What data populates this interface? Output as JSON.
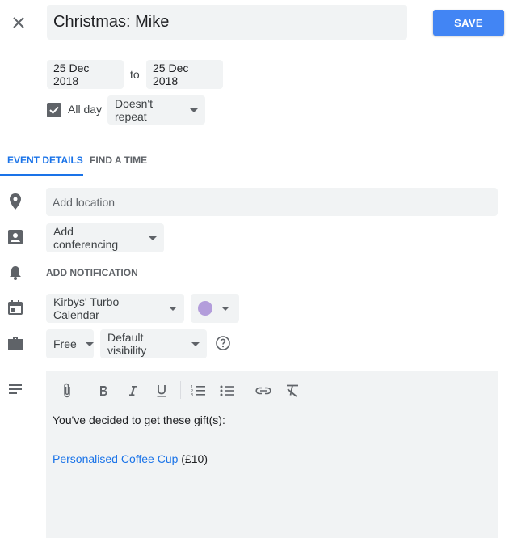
{
  "header": {
    "title_value": "Christmas: Mike",
    "save_label": "SAVE"
  },
  "dates": {
    "start": "25 Dec 2018",
    "separator": "to",
    "end": "25 Dec 2018"
  },
  "all_day": {
    "label": "All day",
    "checked": true
  },
  "repeat": {
    "selected": "Doesn't repeat"
  },
  "tabs": [
    {
      "label": "EVENT DETAILS",
      "active": true
    },
    {
      "label": "FIND A TIME",
      "active": false
    }
  ],
  "location": {
    "placeholder": "Add location"
  },
  "conferencing": {
    "label": "Add conferencing"
  },
  "notification": {
    "label": "ADD NOTIFICATION"
  },
  "calendar": {
    "selected": "Kirbys' Turbo Calendar",
    "color": "#b39ddb"
  },
  "availability": {
    "selected": "Free"
  },
  "visibility": {
    "selected": "Default visibility"
  },
  "description": {
    "line1": "You've decided to get these gift(s):",
    "gift_link": "Personalised Coffee Cup",
    "gift_price": "(£10)"
  },
  "colors": {
    "accent": "#1a73e8",
    "save_button": "#4285f4",
    "field_background": "#f1f3f4"
  }
}
